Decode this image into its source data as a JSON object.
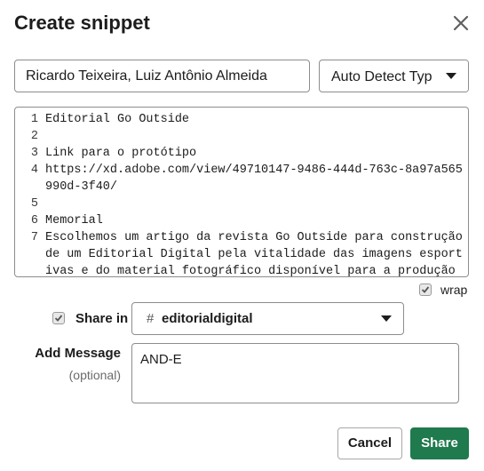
{
  "dialog": {
    "title": "Create snippet",
    "close_icon": "close-icon"
  },
  "snippet": {
    "title_value": "Ricardo Teixeira, Luiz Antônio Almeida",
    "type_label": "Auto Detect Typ",
    "lines": [
      {
        "num": "1",
        "text": "Editorial Go Outside"
      },
      {
        "num": "2",
        "text": ""
      },
      {
        "num": "3",
        "text": "Link para o protótipo"
      },
      {
        "num": "4",
        "text": "https://xd.adobe.com/view/49710147-9486-444d-763c-8a97a565990d-3f40/"
      },
      {
        "num": "5",
        "text": ""
      },
      {
        "num": "6",
        "text": "Memorial"
      },
      {
        "num": "7",
        "text": "Escolhemos um artigo da revista Go Outside para construção de um Editorial Digital pela vitalidade das imagens esportivas e do material fotográfico disponível para a produção deste"
      }
    ],
    "wrap_label": "wrap",
    "wrap_checked": true
  },
  "share": {
    "label": "Share in",
    "checked": true,
    "channel_prefix": "#",
    "channel": "editorialdigital"
  },
  "message": {
    "label": "Add Message",
    "sublabel": "(optional)",
    "value": "AND-E"
  },
  "buttons": {
    "cancel": "Cancel",
    "share": "Share"
  },
  "colors": {
    "share_button": "#1f7a4d",
    "border": "#8d8d8d"
  }
}
